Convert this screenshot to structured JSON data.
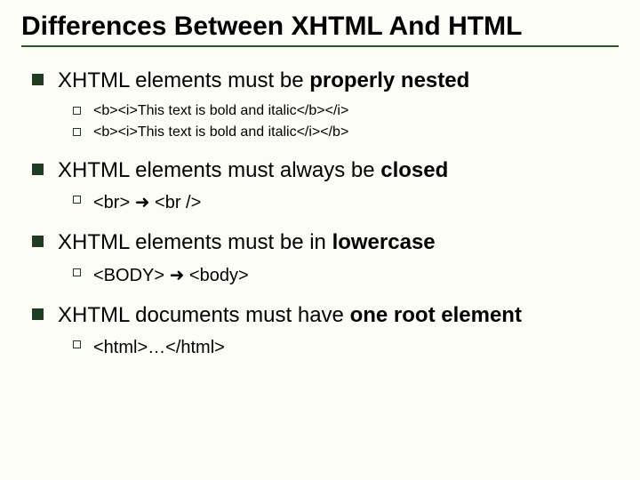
{
  "title": "Differences Between XHTML And HTML",
  "points": [
    {
      "text_pre": "XHTML elements must be ",
      "text_bold": "properly nested",
      "text_post": "",
      "sub_big": false,
      "subs": [
        "<b><i>This text is bold and italic</b></i>",
        "<b><i>This text is bold and italic</i></b>"
      ]
    },
    {
      "text_pre": "XHTML elements must always be ",
      "text_bold": "closed",
      "text_post": "",
      "sub_big": true,
      "subs": [
        "<br> ➜ <br />"
      ]
    },
    {
      "text_pre": "XHTML elements must be in ",
      "text_bold": "lowercase",
      "text_post": "",
      "sub_big": true,
      "subs": [
        "<BODY> ➜ <body>"
      ]
    },
    {
      "text_pre": "XHTML documents must have ",
      "text_bold": "one root element",
      "text_post": "",
      "sub_big": true,
      "subs": [
        "<html>…</html>"
      ]
    }
  ]
}
